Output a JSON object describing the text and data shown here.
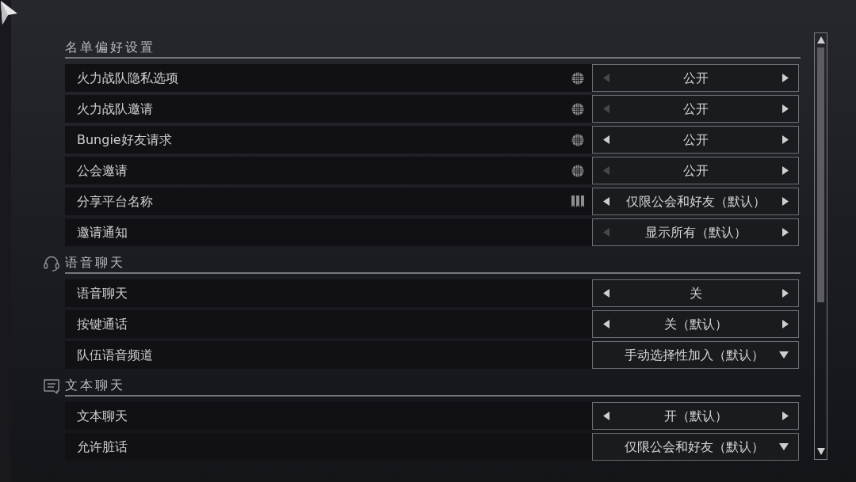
{
  "sections": [
    {
      "title": "名单偏好设置",
      "kind": "plain",
      "rows": [
        {
          "label": "火力战队隐私选项",
          "indicator": {
            "kind": "globe"
          },
          "kind": "stepper",
          "value": "公开",
          "prev_disabled": true
        },
        {
          "label": "火力战队邀请",
          "indicator": {
            "kind": "globe"
          },
          "kind": "stepper",
          "value": "公开",
          "prev_disabled": true
        },
        {
          "label": "Bungie好友请求",
          "indicator": {
            "kind": "globe"
          },
          "kind": "stepper",
          "value": "公开",
          "prev_disabled": false
        },
        {
          "label": "公会邀请",
          "indicator": {
            "kind": "globe"
          },
          "kind": "stepper",
          "value": "公开",
          "prev_disabled": true
        },
        {
          "label": "分享平台名称",
          "indicator": {
            "kind": "bookmarks"
          },
          "kind": "stepper",
          "value": "仅限公会和好友（默认）",
          "prev_disabled": false
        },
        {
          "label": "邀请通知",
          "kind": "stepper",
          "value": "显示所有（默认）",
          "prev_disabled": true
        }
      ]
    },
    {
      "title": "语音聊天",
      "kind": "headset",
      "rows": [
        {
          "label": "语音聊天",
          "kind": "stepper",
          "value": "关",
          "prev_disabled": false
        },
        {
          "label": "按键通话",
          "kind": "stepper",
          "value": "关（默认）",
          "prev_disabled": false
        },
        {
          "label": "队伍语音频道",
          "kind": "dropdown",
          "value": "手动选择性加入（默认）"
        }
      ]
    },
    {
      "title": "文本聊天",
      "kind": "chat",
      "rows": [
        {
          "label": "文本聊天",
          "kind": "stepper",
          "value": "开（默认）",
          "prev_disabled": false
        },
        {
          "label": "允许脏话",
          "kind": "dropdown",
          "value": "仅限公会和好友（默认）"
        }
      ]
    }
  ]
}
